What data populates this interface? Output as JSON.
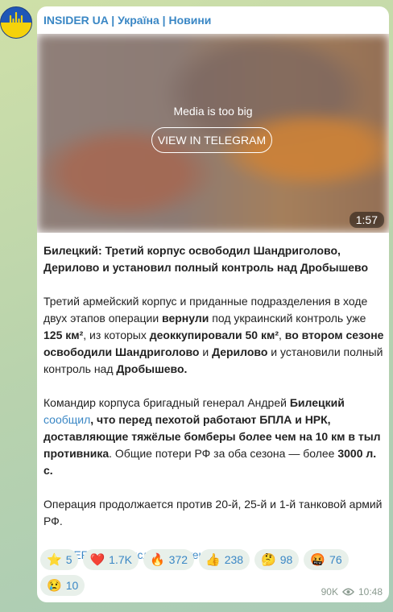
{
  "channel": {
    "name": "INSIDER UA | Україна | Новини"
  },
  "media": {
    "notice": "Media is too big",
    "button_label": "VIEW IN TELEGRAM",
    "duration": "1:57"
  },
  "post": {
    "title": "Билецкий: Третий корпус освободил Шандриголово, Дерилово и установил полный контроль над Дробышево",
    "p1": {
      "t1": "Третий армейский корпус и приданные подразделения в ходе двух этапов операции ",
      "b1": "вернули",
      "t2": " под украинский контроль уже ",
      "b2": "125 км²",
      "t3": ", из которых ",
      "b3": "деоккупировали 50 км²",
      "t4": ", ",
      "b4": "во втором сезоне освободили Шандриголово",
      "t5": " и ",
      "b5": "Дерилово",
      "t6": " и установили полный контроль над ",
      "b6": "Дробышево."
    },
    "p2": {
      "t1": "Командир корпуса бригадный генерал Андрей ",
      "b1": "Билецкий",
      "link": "сообщил",
      "b2": ", что перед пехотой работают БПЛА и НРК, доставляющие тяжёлые бомберы более чем на 10 км в тыл противника",
      "t2": ". Общие потери РФ за оба сезона — более ",
      "b3": "3000 л. с."
    },
    "p3": "Операция продолжается против 20-й, 25-й и 1-й танковой армий РФ.",
    "footer_link1": "INSIDER UA",
    "footer_sep": " | ",
    "footer_link2": "Прислать контент"
  },
  "reactions": [
    {
      "emoji": "⭐",
      "count": "5",
      "icon": "star-icon"
    },
    {
      "emoji": "❤️",
      "count": "1.7K",
      "icon": "heart-icon"
    },
    {
      "emoji": "🔥",
      "count": "372",
      "icon": "fire-icon"
    },
    {
      "emoji": "👍",
      "count": "238",
      "icon": "thumbs-up-icon"
    },
    {
      "emoji": "🤔",
      "count": "98",
      "icon": "thinking-face-icon"
    },
    {
      "emoji": "🤬",
      "count": "76",
      "icon": "angry-face-icon"
    },
    {
      "emoji": "😢",
      "count": "10",
      "icon": "crying-face-icon"
    }
  ],
  "meta": {
    "views": "90K",
    "time": "10:48"
  },
  "colors": {
    "link": "#3a87c5",
    "reaction_bg": "#e8f0ea",
    "background": "#c7d9a9"
  }
}
